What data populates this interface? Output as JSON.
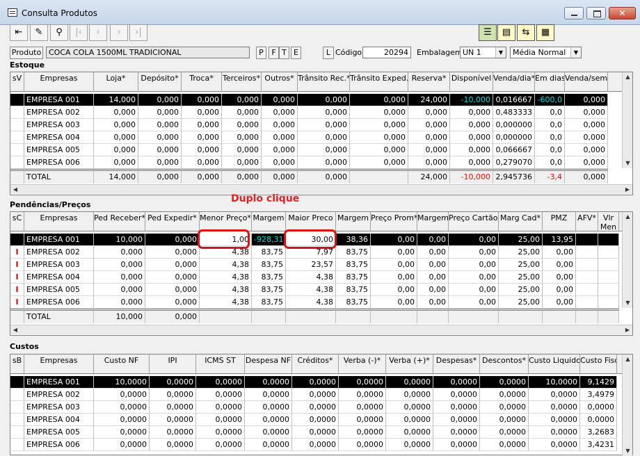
{
  "window": {
    "title": "Consulta Produtos",
    "close_glyph": "✕"
  },
  "toolbar": {
    "buttons": [
      {
        "name": "exit-icon",
        "glyph": "⇤",
        "disabled": false
      },
      {
        "name": "eraser-icon",
        "glyph": "✎",
        "disabled": false
      },
      {
        "name": "binoculars-icon",
        "glyph": "⚲",
        "disabled": false
      },
      {
        "name": "first-record-icon",
        "glyph": "|‹",
        "disabled": true
      },
      {
        "name": "previous-record-icon",
        "glyph": "‹",
        "disabled": true
      },
      {
        "name": "next-record-icon",
        "glyph": "›",
        "disabled": true
      },
      {
        "name": "last-record-icon",
        "glyph": "›|",
        "disabled": true
      }
    ],
    "view_buttons": [
      {
        "name": "view-grid-icon",
        "glyph": "☰"
      },
      {
        "name": "view-form-icon",
        "glyph": "▤"
      },
      {
        "name": "view-split-icon",
        "glyph": "⇆"
      },
      {
        "name": "view-detail-icon",
        "glyph": "▦"
      }
    ]
  },
  "product": {
    "label": "Produto",
    "description": "COCA COLA 1500ML TRADICIONAL",
    "flag_buttons": [
      "P",
      "F",
      "T",
      "E"
    ],
    "l_button": "L",
    "codigo_label": "Código",
    "codigo_value": "20294",
    "embalagem_label": "Embalagem",
    "embalagem_value": "UN  1",
    "media_value": "Média Normal"
  },
  "annotation": {
    "text": "Duplo clique",
    "color": "#e02020"
  },
  "estoque": {
    "title": "Estoque",
    "columns": [
      "sV",
      "Empresas",
      "Loja*",
      "Depósito*",
      "Troca*",
      "Terceiros*",
      "Outros*",
      "Trânsito Rec.*",
      "Trânsito Exped.*",
      "Reserva*",
      "Disponível",
      "Venda/dia*",
      "Em dias",
      "Venda/sem*"
    ],
    "rows": [
      [
        "",
        "EMPRESA 001",
        "14,000",
        "0,000",
        "0,000",
        "0,000",
        "0,000",
        "0,000",
        "0,000",
        "24,000",
        "-10,000",
        "0,016667",
        "-600,0",
        "0,000"
      ],
      [
        "",
        "EMPRESA 002",
        "0,000",
        "0,000",
        "0,000",
        "0,000",
        "0,000",
        "0,000",
        "0,000",
        "0,000",
        "0,000",
        "0,483333",
        "0,0",
        "0,000"
      ],
      [
        "",
        "EMPRESA 003",
        "0,000",
        "0,000",
        "0,000",
        "0,000",
        "0,000",
        "0,000",
        "0,000",
        "0,000",
        "0,000",
        "0,000000",
        "0,0",
        "0,000"
      ],
      [
        "",
        "EMPRESA 004",
        "0,000",
        "0,000",
        "0,000",
        "0,000",
        "0,000",
        "0,000",
        "0,000",
        "0,000",
        "0,000",
        "0,000000",
        "0,0",
        "0,000"
      ],
      [
        "",
        "EMPRESA 005",
        "0,000",
        "0,000",
        "0,000",
        "0,000",
        "0,000",
        "0,000",
        "0,000",
        "0,000",
        "0,000",
        "0,066667",
        "0,0",
        "0,000"
      ],
      [
        "",
        "EMPRESA 006",
        "0,000",
        "0,000",
        "0,000",
        "0,000",
        "0,000",
        "0,000",
        "0,000",
        "0,000",
        "0,000",
        "0,279070",
        "0,0",
        "0,000"
      ]
    ],
    "total": [
      "",
      "TOTAL",
      "14,000",
      "0,000",
      "0,000",
      "0,000",
      "0,000",
      "0,000",
      "",
      "24,000",
      "-10,000",
      "2,945736",
      "-3,4",
      "0,000"
    ]
  },
  "pendencias": {
    "title": "Pendências/Preços",
    "columns": [
      "sC",
      "Empresas",
      "Ped Receber*",
      "Ped Expedir*",
      "Menor Preço*",
      "Margem",
      "Maior Preco",
      "Margem",
      "Preço Prom*",
      "Margem",
      "Preço Cartão*",
      "Marg Cad*",
      "PMZ",
      "AFV*",
      "Vlr\nMen"
    ],
    "rows": [
      [
        "",
        "EMPRESA 001",
        "10,000",
        "0,000",
        "1,00",
        "-928,31",
        "30,00",
        "38,36",
        "0,00",
        "0,00",
        "0,00",
        "25,00",
        "13,95",
        "",
        ""
      ],
      [
        "I",
        "EMPRESA 002",
        "0,000",
        "0,000",
        "4,38",
        "83,75",
        "7,97",
        "83,75",
        "0,00",
        "0,00",
        "0,00",
        "25,00",
        "0,00",
        "",
        ""
      ],
      [
        "I",
        "EMPRESA 003",
        "0,000",
        "0,000",
        "4,38",
        "83,75",
        "23,57",
        "83,75",
        "0,00",
        "0,00",
        "0,00",
        "25,00",
        "0,00",
        "",
        ""
      ],
      [
        "I",
        "EMPRESA 004",
        "0,000",
        "0,000",
        "4,38",
        "83,75",
        "4,38",
        "83,75",
        "0,00",
        "0,00",
        "0,00",
        "25,00",
        "0,00",
        "",
        ""
      ],
      [
        "I",
        "EMPRESA 005",
        "0,000",
        "0,000",
        "4,38",
        "83,75",
        "4,38",
        "83,75",
        "0,00",
        "0,00",
        "0,00",
        "25,00",
        "0,00",
        "",
        ""
      ],
      [
        "I",
        "EMPRESA 006",
        "0,000",
        "0,000",
        "4,38",
        "83,75",
        "4,38",
        "83,75",
        "0,00",
        "0,00",
        "0,00",
        "25,00",
        "0,00",
        "",
        ""
      ]
    ],
    "total": [
      "",
      "TOTAL",
      "10,000",
      "0,000",
      "",
      "",
      "",
      "",
      "",
      "",
      "",
      "",
      "",
      "",
      ""
    ]
  },
  "custos": {
    "title": "Custos",
    "columns": [
      "sB",
      "Empresas",
      "Custo NF",
      "IPI",
      "ICMS ST",
      "Despesa NF",
      "Créditos*",
      "Verba (-)*",
      "Verba (+)*",
      "Despesas*",
      "Descontos*",
      "Custo Liquido*",
      "Custo Fiscal"
    ],
    "rows": [
      [
        "",
        "EMPRESA 001",
        "10,0000",
        "0,0000",
        "0,0000",
        "0,0000",
        "0,0000",
        "0,0000",
        "0,0000",
        "0,0000",
        "0,0000",
        "10,0000",
        "9,1429"
      ],
      [
        "",
        "EMPRESA 002",
        "0,0000",
        "0,0000",
        "0,0000",
        "0,0000",
        "0,0000",
        "0,0000",
        "0,0000",
        "0,0000",
        "0,0000",
        "0,0000",
        "3,4979"
      ],
      [
        "",
        "EMPRESA 003",
        "0,0000",
        "0,0000",
        "0,0000",
        "0,0000",
        "0,0000",
        "0,0000",
        "0,0000",
        "0,0000",
        "0,0000",
        "0,0000",
        "0,0000"
      ],
      [
        "",
        "EMPRESA 004",
        "0,0000",
        "0,0000",
        "0,0000",
        "0,0000",
        "0,0000",
        "0,0000",
        "0,0000",
        "0,0000",
        "0,0000",
        "0,0000",
        "0,0000"
      ],
      [
        "",
        "EMPRESA 005",
        "0,0000",
        "0,0000",
        "0,0000",
        "0,0000",
        "0,0000",
        "0,0000",
        "0,0000",
        "0,0000",
        "0,0000",
        "0,0000",
        "3,2683"
      ],
      [
        "",
        "EMPRESA 006",
        "0,0000",
        "0,0000",
        "0,0000",
        "0,0000",
        "0,0000",
        "0,0000",
        "0,0000",
        "0,0000",
        "0,0000",
        "0,0000",
        "3,4231"
      ]
    ]
  },
  "scroll": {
    "up": "▲",
    "down": "▼",
    "left": "◀",
    "right": "▶"
  }
}
